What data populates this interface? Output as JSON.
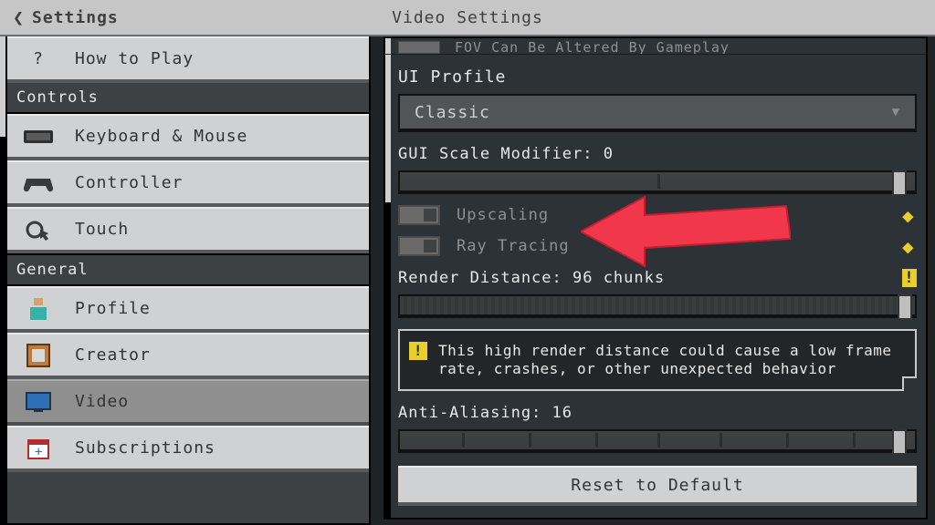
{
  "header": {
    "back_label": "Settings",
    "title": "Video Settings"
  },
  "sidebar": {
    "how_to_play": "How to Play",
    "sections": {
      "controls": {
        "header": "Controls",
        "items": [
          "Keyboard & Mouse",
          "Controller",
          "Touch"
        ]
      },
      "general": {
        "header": "General",
        "items": [
          "Profile",
          "Creator",
          "Video",
          "Subscriptions"
        ]
      }
    },
    "selected": "Video"
  },
  "panel": {
    "cutoff_toggle_label": "FOV Can Be Altered By Gameplay",
    "ui_profile": {
      "label": "UI Profile",
      "value": "Classic"
    },
    "gui_scale": {
      "label": "GUI Scale Modifier: 0",
      "value": 0,
      "pct": 97
    },
    "upscaling": {
      "label": "Upscaling",
      "enabled": false
    },
    "ray_tracing": {
      "label": "Ray Tracing",
      "enabled": false
    },
    "render_distance": {
      "label": "Render Distance: 96 chunks",
      "value": 96,
      "pct": 98
    },
    "warning_text": "This high render distance could cause a low frame rate, crashes, or other unexpected behavior",
    "anti_aliasing": {
      "label": "Anti-Aliasing: 16",
      "value": 16,
      "pct": 97
    },
    "reset_label": "Reset to Default"
  },
  "colors": {
    "accent_yellow": "#e9cf2b",
    "arrow": "#f0374b"
  }
}
